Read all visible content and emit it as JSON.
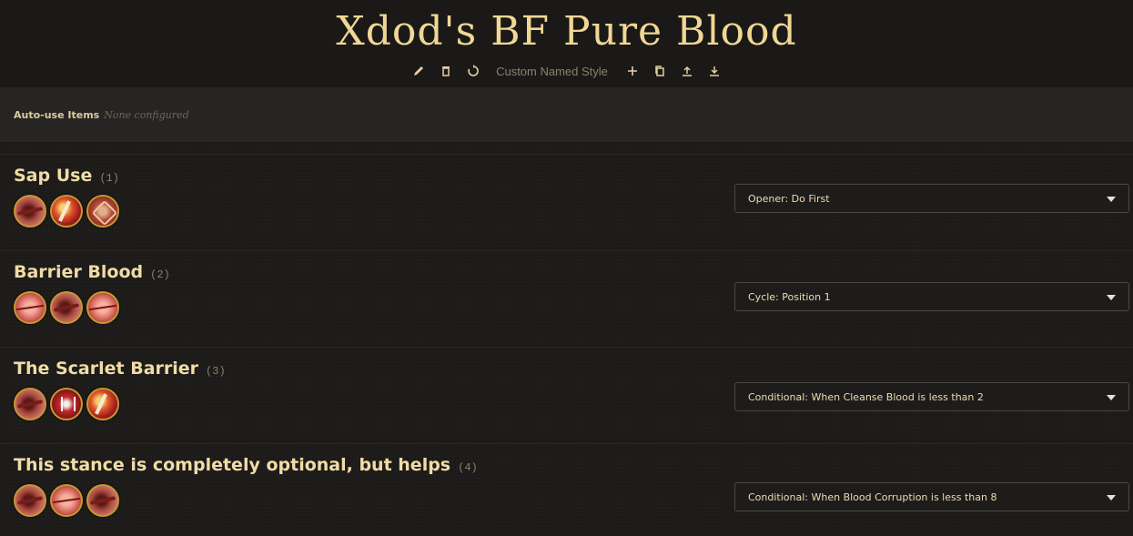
{
  "header": {
    "title": "Xdod's BF Pure Blood",
    "style_name": "Custom Named Style",
    "toolbar_icons": [
      "pencil-icon",
      "trash-icon",
      "refresh-icon",
      "plus-icon",
      "copy-icon",
      "upload-icon",
      "download-icon"
    ]
  },
  "auto_use": {
    "label": "Auto-use Items",
    "value": "None configured"
  },
  "sections": [
    {
      "title": "Sap Use",
      "count": "(1)",
      "icons": [
        "thrust",
        "dagger",
        "rune"
      ],
      "selected": "Opener: Do First"
    },
    {
      "title": "Barrier Blood",
      "count": "(2)",
      "icons": [
        "slash",
        "thrust",
        "slash"
      ],
      "selected": "Cycle: Position 1"
    },
    {
      "title": "The Scarlet Barrier",
      "count": "(3)",
      "icons": [
        "thrust",
        "fang",
        "dagger"
      ],
      "selected": "Conditional: When Cleanse Blood is less than 2"
    },
    {
      "title": "This stance is completely optional, but helps",
      "count": "(4)",
      "icons": [
        "thrust",
        "slash",
        "thrust"
      ],
      "selected": "Conditional: When Blood Corruption is less than 8"
    }
  ],
  "colors": {
    "background": "#1c1b19",
    "title": "#f1d795",
    "icon_border": "#c9972f"
  }
}
